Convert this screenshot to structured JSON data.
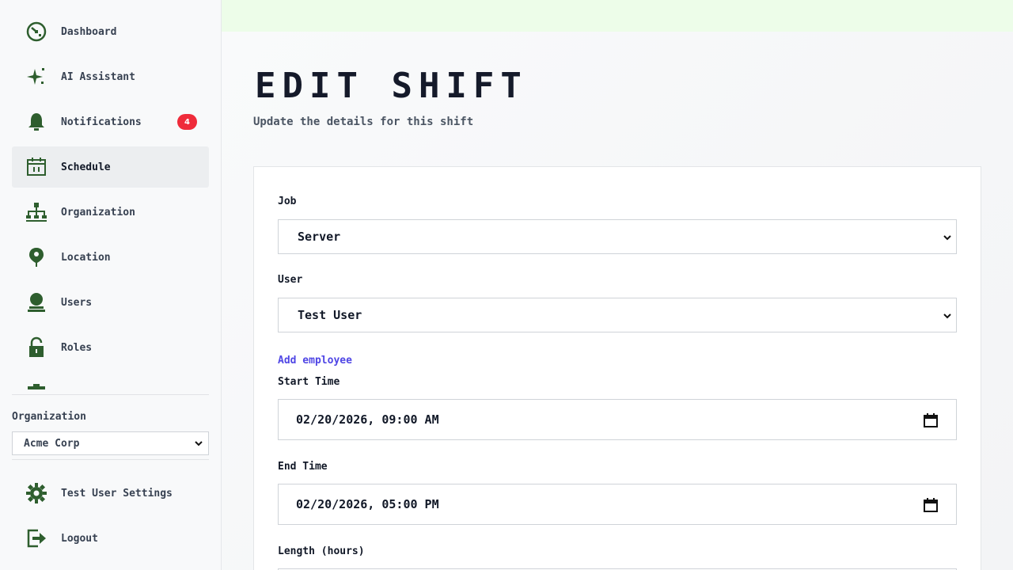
{
  "sidebar": {
    "items": [
      {
        "label": "Dashboard",
        "icon": "dashboard-icon"
      },
      {
        "label": "AI Assistant",
        "icon": "sparkle-icon"
      },
      {
        "label": "Notifications",
        "icon": "bell-icon",
        "badge": "4"
      },
      {
        "label": "Schedule",
        "icon": "calendar-icon",
        "active": true
      },
      {
        "label": "Organization",
        "icon": "org-chart-icon"
      },
      {
        "label": "Location",
        "icon": "location-pin-icon"
      },
      {
        "label": "Users",
        "icon": "user-icon"
      },
      {
        "label": "Roles",
        "icon": "lock-icon"
      }
    ],
    "org_label": "Organization",
    "org_value": "Acme Corp",
    "settings_label": "Test User Settings",
    "logout_label": "Logout"
  },
  "main": {
    "title": "Edit Shift",
    "subtitle": "Update the details for this shift",
    "form": {
      "job_label": "Job",
      "job_value": "Server",
      "user_label": "User",
      "user_value": "Test User",
      "add_employee": "Add employee",
      "start_label": "Start Time",
      "start_value": "02/20/2026, 09:00 AM",
      "end_label": "End Time",
      "end_value": "02/20/2026, 05:00 PM",
      "length_label": "Length (hours)"
    }
  },
  "colors": {
    "icon_green": "#2e5e2e",
    "badge_red": "#ef2b3a",
    "link_purple": "#4f46e5",
    "topbar_green": "#edfde9"
  }
}
